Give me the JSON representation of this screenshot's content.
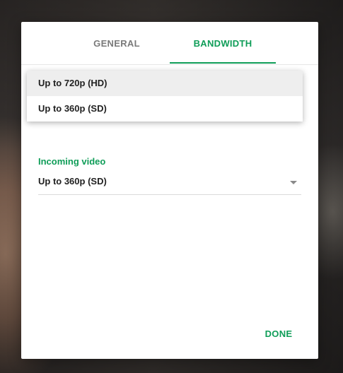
{
  "tabs": [
    {
      "label": "GENERAL",
      "active": false
    },
    {
      "label": "BANDWIDTH",
      "active": true
    }
  ],
  "dropdown_menu": {
    "items": [
      {
        "label": "Up to 720p (HD)",
        "highlighted": true
      },
      {
        "label": "Up to 360p (SD)",
        "highlighted": false
      }
    ]
  },
  "incoming_video": {
    "label": "Incoming video",
    "value": "Up to 360p (SD)"
  },
  "actions": {
    "done_label": "DONE"
  },
  "colors": {
    "accent": "#0f9d58",
    "inactive_tab": "#7a7a7a",
    "text": "#212121"
  }
}
